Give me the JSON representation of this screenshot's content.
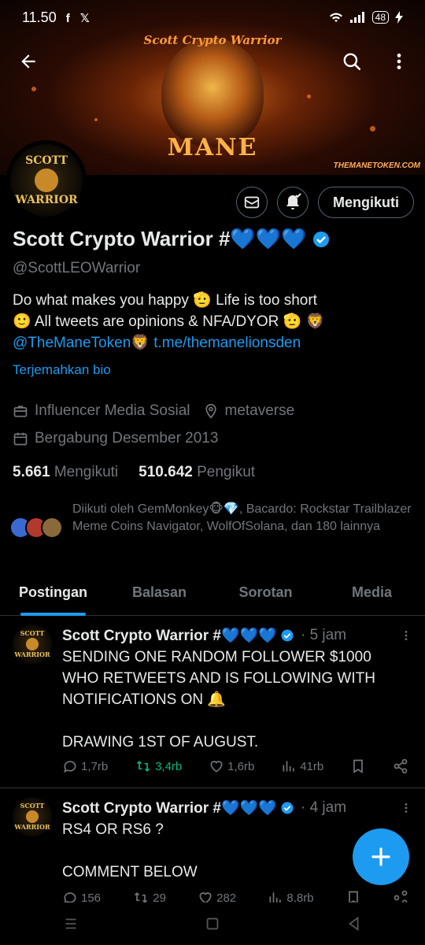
{
  "status_bar": {
    "time": "11.50",
    "left_icons": [
      "f",
      "𝕏"
    ],
    "battery": "48"
  },
  "banner": {
    "title": "Scott Crypto Warrior",
    "word": "MANE",
    "site": "THEMANETOKEN.COM"
  },
  "avatar": {
    "line1": "SCOTT",
    "line2": "WARRIOR"
  },
  "profile": {
    "name": "Scott Crypto Warrior #💙💙💙",
    "handle": "@ScottLEOWarrior",
    "follow_label": "Mengikuti",
    "bio_line1": "Do what makes you happy 🫡  Life is too short",
    "bio_line2": "🙂  All tweets are opinions & NFA/DYOR 🫡  🦁",
    "bio_link1": "@TheManeToken🦁",
    "bio_link2": "t.me/themanelionsden",
    "translate": "Terjemahkan bio",
    "category": "Influencer Media Sosial",
    "location": "metaverse",
    "joined": "Bergabung Desember 2013",
    "following_count": "5.661",
    "following_label": "Mengikuti",
    "followers_count": "510.642",
    "followers_label": "Pengikut",
    "followed_by": "Diikuti oleh GemMonkey🐵💎, Bacardo: Rockstar Trailblazer Meme Coins Navigator, WolfOfSolana, dan 180 lainnya"
  },
  "tabs": [
    "Postingan",
    "Balasan",
    "Sorotan",
    "Media"
  ],
  "tweets": [
    {
      "name": "Scott Crypto Warrior #💙💙💙",
      "meta": "· 5 jam",
      "text": "SENDING ONE RANDOM FOLLOWER $1000\nWHO RETWEETS AND IS FOLLOWING WITH\nNOTIFICATIONS ON 🔔\n\nDRAWING 1ST OF AUGUST.",
      "replies": "1,7rb",
      "retweets": "3,4rb",
      "likes": "1,6rb",
      "views": "41rb"
    },
    {
      "name": "Scott Crypto Warrior #💙💙💙",
      "meta": "· 4 jam",
      "text": "RS4 OR RS6 ?\n\nCOMMENT BELOW",
      "replies": "156",
      "retweets": "29",
      "likes": "282",
      "views": "8,8rb"
    }
  ],
  "accent_color": "#1d9bf0"
}
